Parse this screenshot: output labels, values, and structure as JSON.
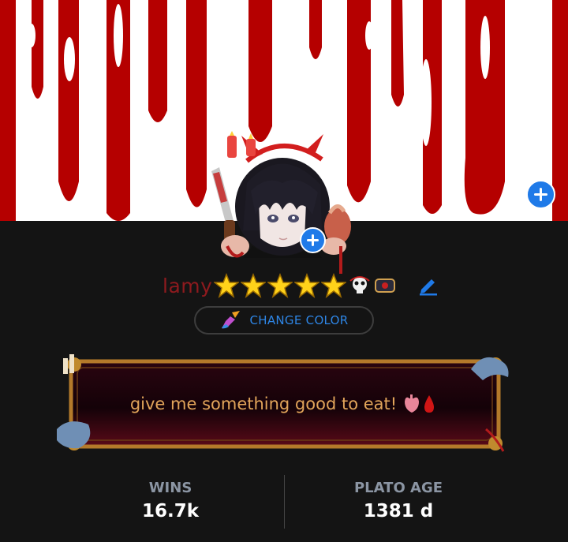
{
  "profile": {
    "username": "lamy",
    "star_count": 5,
    "change_color_label": "CHANGE COLOR",
    "bio": "give me something good to eat!"
  },
  "stats": {
    "wins_label": "WINS",
    "wins_value": "16.7k",
    "age_label": "PLATO AGE",
    "age_value": "1381 d"
  },
  "icons": {
    "banner_add": "plus-icon",
    "avatar_add": "plus-icon",
    "edit": "pencil-icon",
    "change_color": "paintbrush-icon",
    "bio_emojis": [
      "anatomical-heart-icon",
      "blood-drop-icon"
    ]
  },
  "colors": {
    "banner_red": "#b50000",
    "accent_blue": "#1f7ae8",
    "username": "#8e1a1e",
    "bio_text": "#e1a45a",
    "stat_label": "#8b95a3"
  }
}
